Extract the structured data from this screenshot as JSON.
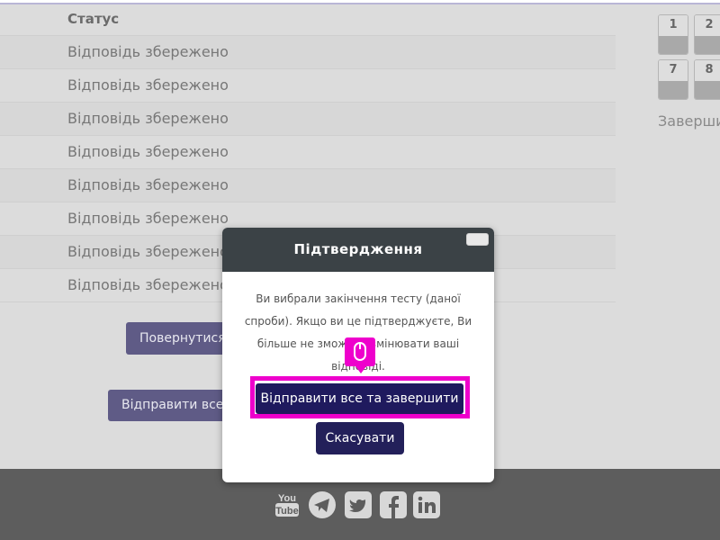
{
  "table": {
    "status_header": "Статус",
    "rows": [
      "Відповідь збережено",
      "Відповідь збережено",
      "Відповідь збережено",
      "Відповідь збережено",
      "Відповідь збережено",
      "Відповідь збережено",
      "Відповідь збережено",
      "Відповідь збережено"
    ]
  },
  "buttons": {
    "back": "Повернутися",
    "submit_all_bg": "Відправити все т"
  },
  "navigation": {
    "blocks": [
      "1",
      "2",
      "7",
      "8"
    ],
    "finish_text": "Заверши"
  },
  "modal": {
    "title": "Підтвердження",
    "body_lines": [
      "Ви вибрали закінчення тесту (даної",
      "спроби). Якщо ви це підтверджуєте, Ви",
      "більше не зможете змінювати ваші",
      "відповіді."
    ],
    "primary_button": "Відправити все та завершити",
    "cancel_button": "Скасувати"
  },
  "footer": {
    "social_icons": [
      "youtube-icon",
      "telegram-icon",
      "twitter-icon",
      "facebook-icon",
      "linkedin-icon"
    ]
  },
  "colors": {
    "highlight": "#ee00cc",
    "modal_header": "#3b4246",
    "primary_button": "#1f1a5e",
    "footer": "#5d5d5d"
  }
}
